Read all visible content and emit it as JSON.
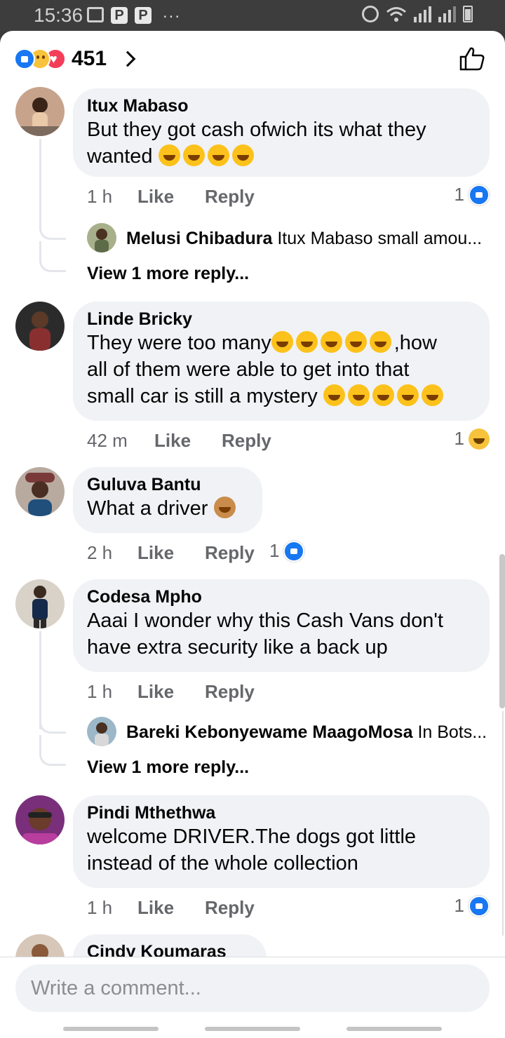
{
  "status_bar": {
    "time": "15:36",
    "icons": [
      "gallery-icon",
      "p-app-icon",
      "p-app-icon",
      "more-dots-icon",
      "alarm-icon",
      "wifi-icon",
      "signal-icon",
      "signal-icon",
      "battery-icon"
    ],
    "p_label": "P",
    "dots": "..."
  },
  "header": {
    "reaction_count": "451",
    "reactions": [
      "like",
      "wow",
      "love"
    ]
  },
  "comments": [
    {
      "name": "Itux Mabaso",
      "text": "But they got cash ofwich its what they wanted",
      "emoji_after": 4,
      "time": "1 h",
      "like_label": "Like",
      "reply_label": "Reply",
      "react_count": "1",
      "react_type": "like",
      "reply_preview": {
        "name": "Melusi Chibadura",
        "text": "Itux Mabaso small amou..."
      },
      "view_more": "View 1 more reply..."
    },
    {
      "name": "Linde Bricky",
      "line1": "They were too many",
      "line1_suffix": ",how",
      "line2": "all of them were able to get into that",
      "line3": "small car is still a mystery",
      "time": "42 m",
      "like_label": "Like",
      "reply_label": "Reply",
      "react_count": "1",
      "react_type": "haha"
    },
    {
      "name": "Guluva Bantu",
      "text": "What a driver",
      "time": "2 h",
      "like_label": "Like",
      "reply_label": "Reply",
      "react_count": "1",
      "react_type": "like"
    },
    {
      "name": "Codesa Mpho",
      "text": "Aaai I wonder why this Cash Vans don't have extra security like a back up",
      "time": "1 h",
      "like_label": "Like",
      "reply_label": "Reply",
      "reply_preview": {
        "name": "Bareki Kebonyewame MaagoMosa",
        "text": "In Bots..."
      },
      "view_more": "View 1 more reply..."
    },
    {
      "name": "Pindi Mthethwa",
      "text": "welcome DRIVER.The dogs got little instead of the whole collection",
      "time": "1 h",
      "like_label": "Like",
      "reply_label": "Reply",
      "react_count": "1",
      "react_type": "like"
    },
    {
      "name": "Cindy Koumaras"
    }
  ],
  "composer": {
    "placeholder": "Write a comment..."
  },
  "colors": {
    "like_blue": "#1877f2",
    "bubble_bg": "#f0f2f5",
    "meta_gray": "#65676b"
  }
}
